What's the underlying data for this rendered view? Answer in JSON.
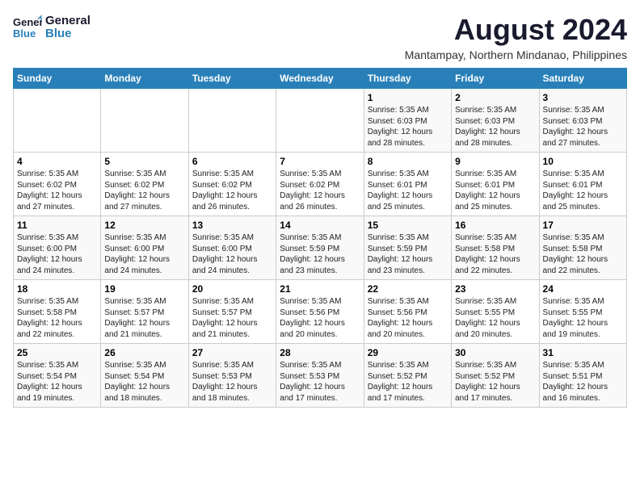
{
  "header": {
    "logo_line1": "General",
    "logo_line2": "Blue",
    "month_year": "August 2024",
    "location": "Mantampay, Northern Mindanao, Philippines"
  },
  "weekdays": [
    "Sunday",
    "Monday",
    "Tuesday",
    "Wednesday",
    "Thursday",
    "Friday",
    "Saturday"
  ],
  "weeks": [
    [
      {
        "day": "",
        "info": ""
      },
      {
        "day": "",
        "info": ""
      },
      {
        "day": "",
        "info": ""
      },
      {
        "day": "",
        "info": ""
      },
      {
        "day": "1",
        "info": "Sunrise: 5:35 AM\nSunset: 6:03 PM\nDaylight: 12 hours\nand 28 minutes."
      },
      {
        "day": "2",
        "info": "Sunrise: 5:35 AM\nSunset: 6:03 PM\nDaylight: 12 hours\nand 28 minutes."
      },
      {
        "day": "3",
        "info": "Sunrise: 5:35 AM\nSunset: 6:03 PM\nDaylight: 12 hours\nand 27 minutes."
      }
    ],
    [
      {
        "day": "4",
        "info": "Sunrise: 5:35 AM\nSunset: 6:02 PM\nDaylight: 12 hours\nand 27 minutes."
      },
      {
        "day": "5",
        "info": "Sunrise: 5:35 AM\nSunset: 6:02 PM\nDaylight: 12 hours\nand 27 minutes."
      },
      {
        "day": "6",
        "info": "Sunrise: 5:35 AM\nSunset: 6:02 PM\nDaylight: 12 hours\nand 26 minutes."
      },
      {
        "day": "7",
        "info": "Sunrise: 5:35 AM\nSunset: 6:02 PM\nDaylight: 12 hours\nand 26 minutes."
      },
      {
        "day": "8",
        "info": "Sunrise: 5:35 AM\nSunset: 6:01 PM\nDaylight: 12 hours\nand 25 minutes."
      },
      {
        "day": "9",
        "info": "Sunrise: 5:35 AM\nSunset: 6:01 PM\nDaylight: 12 hours\nand 25 minutes."
      },
      {
        "day": "10",
        "info": "Sunrise: 5:35 AM\nSunset: 6:01 PM\nDaylight: 12 hours\nand 25 minutes."
      }
    ],
    [
      {
        "day": "11",
        "info": "Sunrise: 5:35 AM\nSunset: 6:00 PM\nDaylight: 12 hours\nand 24 minutes."
      },
      {
        "day": "12",
        "info": "Sunrise: 5:35 AM\nSunset: 6:00 PM\nDaylight: 12 hours\nand 24 minutes."
      },
      {
        "day": "13",
        "info": "Sunrise: 5:35 AM\nSunset: 6:00 PM\nDaylight: 12 hours\nand 24 minutes."
      },
      {
        "day": "14",
        "info": "Sunrise: 5:35 AM\nSunset: 5:59 PM\nDaylight: 12 hours\nand 23 minutes."
      },
      {
        "day": "15",
        "info": "Sunrise: 5:35 AM\nSunset: 5:59 PM\nDaylight: 12 hours\nand 23 minutes."
      },
      {
        "day": "16",
        "info": "Sunrise: 5:35 AM\nSunset: 5:58 PM\nDaylight: 12 hours\nand 22 minutes."
      },
      {
        "day": "17",
        "info": "Sunrise: 5:35 AM\nSunset: 5:58 PM\nDaylight: 12 hours\nand 22 minutes."
      }
    ],
    [
      {
        "day": "18",
        "info": "Sunrise: 5:35 AM\nSunset: 5:58 PM\nDaylight: 12 hours\nand 22 minutes."
      },
      {
        "day": "19",
        "info": "Sunrise: 5:35 AM\nSunset: 5:57 PM\nDaylight: 12 hours\nand 21 minutes."
      },
      {
        "day": "20",
        "info": "Sunrise: 5:35 AM\nSunset: 5:57 PM\nDaylight: 12 hours\nand 21 minutes."
      },
      {
        "day": "21",
        "info": "Sunrise: 5:35 AM\nSunset: 5:56 PM\nDaylight: 12 hours\nand 20 minutes."
      },
      {
        "day": "22",
        "info": "Sunrise: 5:35 AM\nSunset: 5:56 PM\nDaylight: 12 hours\nand 20 minutes."
      },
      {
        "day": "23",
        "info": "Sunrise: 5:35 AM\nSunset: 5:55 PM\nDaylight: 12 hours\nand 20 minutes."
      },
      {
        "day": "24",
        "info": "Sunrise: 5:35 AM\nSunset: 5:55 PM\nDaylight: 12 hours\nand 19 minutes."
      }
    ],
    [
      {
        "day": "25",
        "info": "Sunrise: 5:35 AM\nSunset: 5:54 PM\nDaylight: 12 hours\nand 19 minutes."
      },
      {
        "day": "26",
        "info": "Sunrise: 5:35 AM\nSunset: 5:54 PM\nDaylight: 12 hours\nand 18 minutes."
      },
      {
        "day": "27",
        "info": "Sunrise: 5:35 AM\nSunset: 5:53 PM\nDaylight: 12 hours\nand 18 minutes."
      },
      {
        "day": "28",
        "info": "Sunrise: 5:35 AM\nSunset: 5:53 PM\nDaylight: 12 hours\nand 17 minutes."
      },
      {
        "day": "29",
        "info": "Sunrise: 5:35 AM\nSunset: 5:52 PM\nDaylight: 12 hours\nand 17 minutes."
      },
      {
        "day": "30",
        "info": "Sunrise: 5:35 AM\nSunset: 5:52 PM\nDaylight: 12 hours\nand 17 minutes."
      },
      {
        "day": "31",
        "info": "Sunrise: 5:35 AM\nSunset: 5:51 PM\nDaylight: 12 hours\nand 16 minutes."
      }
    ]
  ]
}
